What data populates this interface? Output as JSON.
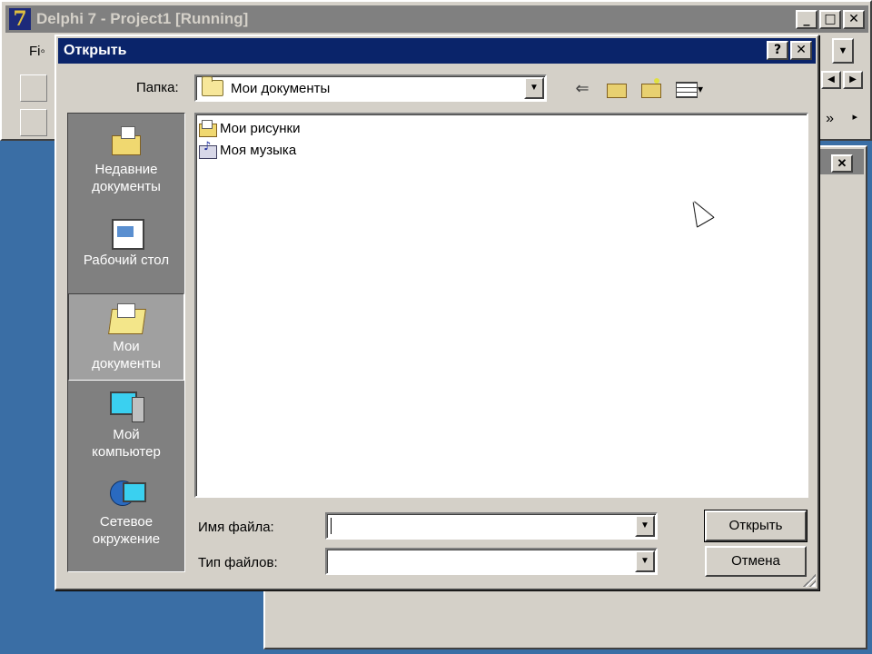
{
  "ide": {
    "title": "Delphi 7 - Project1 [Running]",
    "logo": "7",
    "menu_fragment": "Fi◦",
    "caption_buttons": [
      "_",
      "□",
      "✕"
    ]
  },
  "form_bg": {
    "close": "✕"
  },
  "dialog": {
    "title": "Открыть",
    "help_button": "?",
    "close_button": "✕",
    "folder_label": "Папка:",
    "folder_value": "Мои документы",
    "nav_tools": [
      "back-icon",
      "up-folder-icon",
      "new-folder-icon",
      "view-menu-icon"
    ],
    "places": [
      {
        "label_line1": "Недавние",
        "label_line2": "документы",
        "icon": "recent-documents-icon"
      },
      {
        "label_line1": "Рабочий стол",
        "label_line2": "",
        "icon": "desktop-icon"
      },
      {
        "label_line1": "Мои",
        "label_line2": "документы",
        "icon": "my-documents-icon"
      },
      {
        "label_line1": "Мой",
        "label_line2": "компьютер",
        "icon": "my-computer-icon"
      },
      {
        "label_line1": "Сетевое",
        "label_line2": "окружение",
        "icon": "network-icon"
      }
    ],
    "selected_place": "Мои документы",
    "files": [
      {
        "name": "Мои рисунки",
        "icon": "folder-pictures-icon"
      },
      {
        "name": "Моя музыка",
        "icon": "folder-music-icon"
      }
    ],
    "filename_label": "Имя файла:",
    "filename_value": "",
    "filetype_label": "Тип файлов:",
    "filetype_value": "",
    "open_button": "Открыть",
    "cancel_button": "Отмена"
  },
  "colors": {
    "desktop": "#3a6ea5",
    "active_titlebar": "#0a246a",
    "inactive_titlebar": "#808080",
    "face": "#d4d0c8",
    "places_bar": "#808080"
  }
}
